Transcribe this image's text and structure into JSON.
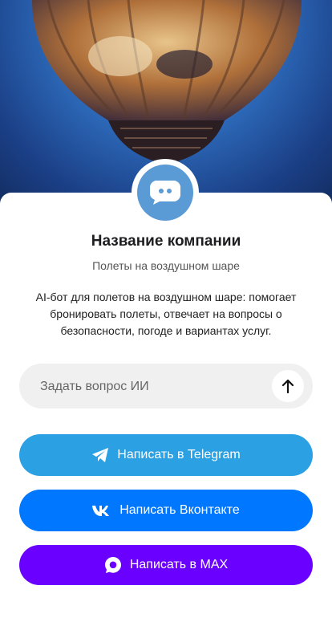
{
  "company": {
    "name": "Название компании",
    "tagline": "Полеты на воздушном шаре",
    "description": "AI-бот для полетов на воздушном шаре: помогает бронировать полеты, отвечает на вопросы о безопасности, погоде и вариантах услуг."
  },
  "ask": {
    "placeholder": "Задать вопрос ИИ"
  },
  "buttons": {
    "telegram": "Написать в Telegram",
    "vk": "Написать Вконтакте",
    "max": "Написать в MAX"
  },
  "colors": {
    "avatar": "#5b9bd5",
    "telegram": "#2ba0e3",
    "vk": "#0077ff",
    "max": "#6a00ff"
  }
}
